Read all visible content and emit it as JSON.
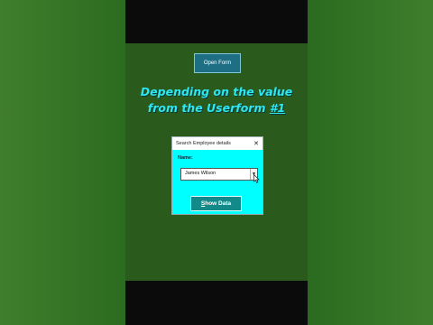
{
  "stage": {
    "open_button_label": "Open Form",
    "caption_line1": "Depending on the value",
    "caption_line2_prefix": "from the Userform ",
    "caption_line2_number": "#1"
  },
  "dialog": {
    "title": "Search Employee details",
    "close_icon": "close-icon",
    "name_label": "Name:",
    "name_combo_value": "James Wilson",
    "show_button_accel": "S",
    "show_button_rest": "how Data"
  },
  "colors": {
    "caption": "#2ee8f0",
    "dialog_background": "#00ffff",
    "stage_background": "#2a5a1c",
    "open_button": "#1f6f84",
    "show_button": "#128a8a"
  }
}
